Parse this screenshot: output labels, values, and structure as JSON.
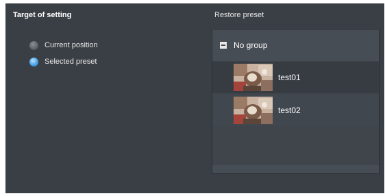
{
  "left_section": {
    "title": "Target of setting",
    "options": [
      {
        "label": "Current position",
        "selected": false
      },
      {
        "label": "Selected preset",
        "selected": true
      }
    ]
  },
  "right_section": {
    "title": "Restore preset",
    "group": {
      "label": "No group",
      "expanded": true
    },
    "presets": [
      {
        "label": "test01",
        "thumbnail": "camera-preset-thumbnail"
      },
      {
        "label": "test02",
        "thumbnail": "camera-preset-thumbnail"
      }
    ]
  },
  "colors": {
    "panel_background": "#3a3f45",
    "selected_radio": "#4aa3e8",
    "text": "#ffffff"
  }
}
